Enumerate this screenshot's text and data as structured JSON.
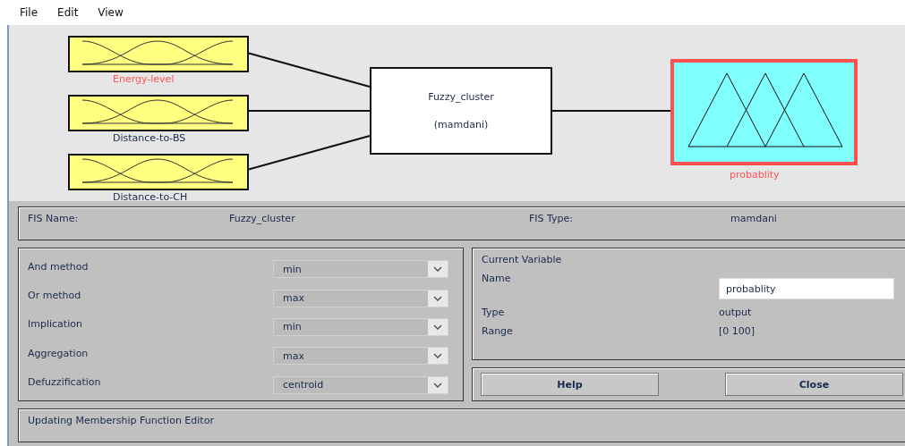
{
  "menu": [
    "File",
    "Edit",
    "View"
  ],
  "inputs": [
    {
      "name": "Energy-level",
      "color": "#ff5555",
      "selected": false
    },
    {
      "name": "Distance-to-BS",
      "color": "#1a2a4a",
      "selected": false
    },
    {
      "name": "Distance-to-CH",
      "color": "#1a2a4a",
      "selected": false
    }
  ],
  "system": {
    "name": "Fuzzy_cluster",
    "type": "(mamdani)"
  },
  "output": {
    "name": "probablity",
    "color": "#ff5555",
    "selected": true
  },
  "fis": {
    "name_label": "FIS Name:",
    "name": "Fuzzy_cluster",
    "type_label": "FIS Type:",
    "type": "mamdani"
  },
  "methods": [
    {
      "label": "And method",
      "value": "min"
    },
    {
      "label": "Or method",
      "value": "max"
    },
    {
      "label": "Implication",
      "value": "min"
    },
    {
      "label": "Aggregation",
      "value": "max"
    },
    {
      "label": "Defuzzification",
      "value": "centroid"
    }
  ],
  "current_variable": {
    "title": "Current Variable",
    "name_label": "Name",
    "name": "probablity",
    "type_label": "Type",
    "type": "output",
    "range_label": "Range",
    "range": "[0 100]"
  },
  "buttons": [
    "Help",
    "Close"
  ],
  "status": "Updating Membership Function Editor"
}
